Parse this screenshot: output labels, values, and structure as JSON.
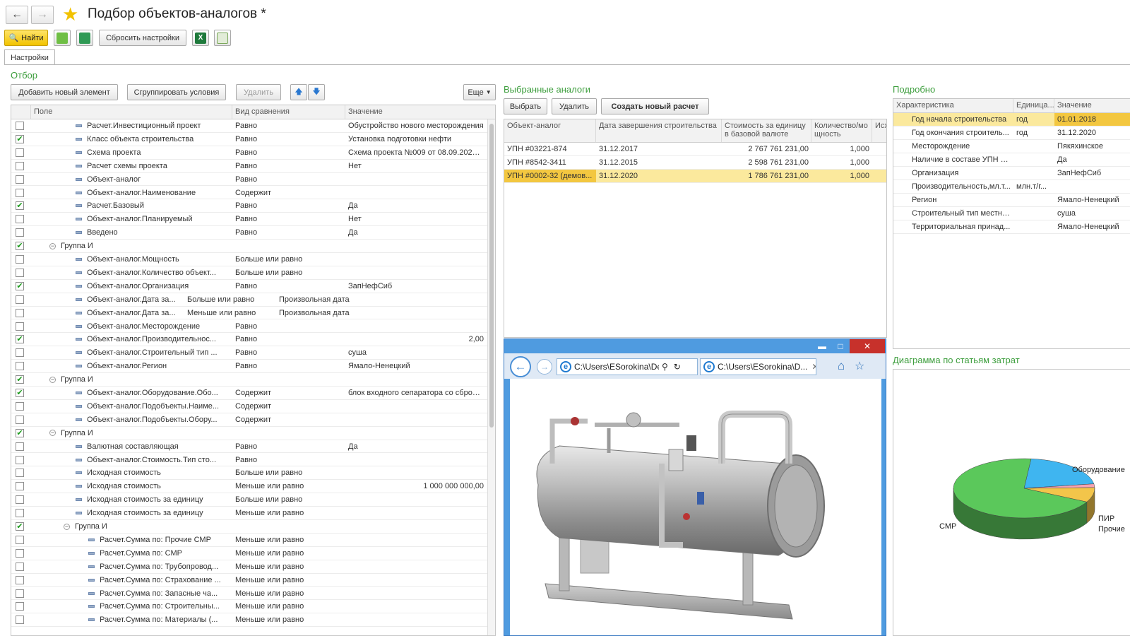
{
  "window": {
    "title": "Подбор объектов-аналогов *"
  },
  "toolbar": {
    "find_label": "Найти",
    "reset_label": "Сбросить настройки"
  },
  "tabs": [
    {
      "label": "Настройки"
    }
  ],
  "filter": {
    "section_title": "Отбор",
    "add_label": "Добавить новый элемент",
    "group_label": "Сгруппировать условия",
    "delete_label": "Удалить",
    "more_label": "Еще",
    "columns": [
      "Поле",
      "Вид сравнения",
      "Значение"
    ],
    "rows": [
      {
        "checked": false,
        "kind": "item",
        "level": 1,
        "field": "Расчет.Инвестиционный проект",
        "cmp": "Равно",
        "value": "Обустройство нового месторождения"
      },
      {
        "checked": true,
        "kind": "item",
        "level": 1,
        "field": "Класс объекта строительства",
        "cmp": "Равно",
        "value": "Установка подготовки нефти"
      },
      {
        "checked": false,
        "kind": "item",
        "level": 1,
        "field": "Схема проекта",
        "cmp": "Равно",
        "value": "Схема проекта №009 от 08.09.2022 14:..."
      },
      {
        "checked": false,
        "kind": "item",
        "level": 1,
        "field": "Расчет схемы проекта",
        "cmp": "Равно",
        "value": "Нет"
      },
      {
        "checked": false,
        "kind": "item",
        "level": 1,
        "field": "Объект-аналог",
        "cmp": "Равно",
        "value": ""
      },
      {
        "checked": false,
        "kind": "item",
        "level": 1,
        "field": "Объект-аналог.Наименование",
        "cmp": "Содержит",
        "value": ""
      },
      {
        "checked": true,
        "kind": "item",
        "level": 1,
        "field": "Расчет.Базовый",
        "cmp": "Равно",
        "value": "Да"
      },
      {
        "checked": false,
        "kind": "item",
        "level": 1,
        "field": "Объект-аналог.Планируемый",
        "cmp": "Равно",
        "value": "Нет"
      },
      {
        "checked": false,
        "kind": "item",
        "level": 1,
        "field": "Введено",
        "cmp": "Равно",
        "value": "Да"
      },
      {
        "checked": true,
        "kind": "group",
        "level": 0,
        "field": "Группа И",
        "cmp": "",
        "value": ""
      },
      {
        "checked": false,
        "kind": "item",
        "level": 1,
        "field": "Объект-аналог.Мощность",
        "cmp": "Больше или равно",
        "value": ""
      },
      {
        "checked": false,
        "kind": "item",
        "level": 1,
        "field": "Объект-аналог.Количество объект...",
        "cmp": "Больше или равно",
        "value": ""
      },
      {
        "checked": true,
        "kind": "item",
        "level": 1,
        "field": "Объект-аналог.Организация",
        "cmp": "Равно",
        "value": "ЗапНефСиб"
      },
      {
        "checked": false,
        "kind": "item",
        "level": 1,
        "field": "Объект-аналог.Дата за...",
        "cmp_inline": "Больше или равно",
        "value_inline": "Произвольная дата",
        "cmp": "",
        "value": ""
      },
      {
        "checked": false,
        "kind": "item",
        "level": 1,
        "field": "Объект-аналог.Дата за...",
        "cmp_inline": "Меньше или равно",
        "value_inline": "Произвольная дата",
        "cmp": "",
        "value": ""
      },
      {
        "checked": false,
        "kind": "item",
        "level": 1,
        "field": "Объект-аналог.Месторождение",
        "cmp": "Равно",
        "value": ""
      },
      {
        "checked": true,
        "kind": "item",
        "level": 1,
        "field": "Объект-аналог.Производительнос...",
        "cmp": "Равно",
        "value": "2,00",
        "num": true
      },
      {
        "checked": false,
        "kind": "item",
        "level": 1,
        "field": "Объект-аналог.Строительный тип ...",
        "cmp": "Равно",
        "value": "суша"
      },
      {
        "checked": false,
        "kind": "item",
        "level": 1,
        "field": "Объект-аналог.Регион",
        "cmp": "Равно",
        "value": "Ямало-Ненецкий"
      },
      {
        "checked": true,
        "kind": "group",
        "level": 0,
        "field": "Группа И",
        "cmp": "",
        "value": ""
      },
      {
        "checked": true,
        "kind": "item",
        "level": 1,
        "field": "Объект-аналог.Оборудование.Обо...",
        "cmp": "Содержит",
        "value": "блок входного сепаратора со сбросом ..."
      },
      {
        "checked": false,
        "kind": "item",
        "level": 1,
        "field": "Объект-аналог.Подобъекты.Наиме...",
        "cmp": "Содержит",
        "value": ""
      },
      {
        "checked": false,
        "kind": "item",
        "level": 1,
        "field": "Объект-аналог.Подобъекты.Обору...",
        "cmp": "Содержит",
        "value": ""
      },
      {
        "checked": true,
        "kind": "group",
        "level": 0,
        "field": "Группа И",
        "cmp": "",
        "value": ""
      },
      {
        "checked": false,
        "kind": "item",
        "level": 1,
        "field": "Валютная составляющая",
        "cmp": "Равно",
        "value": "Да"
      },
      {
        "checked": false,
        "kind": "item",
        "level": 1,
        "field": "Объект-аналог.Стоимость.Тип сто...",
        "cmp": "Равно",
        "value": ""
      },
      {
        "checked": false,
        "kind": "item",
        "level": 1,
        "field": "Исходная стоимость",
        "cmp": "Больше или равно",
        "value": ""
      },
      {
        "checked": false,
        "kind": "item",
        "level": 1,
        "field": "Исходная стоимость",
        "cmp": "Меньше или равно",
        "value": "1 000 000 000,00",
        "num": true
      },
      {
        "checked": false,
        "kind": "item",
        "level": 1,
        "field": "Исходная стоимость за единицу",
        "cmp": "Больше или равно",
        "value": ""
      },
      {
        "checked": false,
        "kind": "item",
        "level": 1,
        "field": "Исходная стоимость за единицу",
        "cmp": "Меньше или равно",
        "value": ""
      },
      {
        "checked": true,
        "kind": "group",
        "level": 1,
        "field": "Группа И",
        "cmp": "",
        "value": ""
      },
      {
        "checked": false,
        "kind": "item",
        "level": 2,
        "field": "Расчет.Сумма по: Прочие СМР",
        "cmp": "Меньше или равно",
        "value": ""
      },
      {
        "checked": false,
        "kind": "item",
        "level": 2,
        "field": "Расчет.Сумма по: СМР",
        "cmp": "Меньше или равно",
        "value": ""
      },
      {
        "checked": false,
        "kind": "item",
        "level": 2,
        "field": "Расчет.Сумма по: Трубопровод...",
        "cmp": "Меньше или равно",
        "value": ""
      },
      {
        "checked": false,
        "kind": "item",
        "level": 2,
        "field": "Расчет.Сумма по: Страхование ...",
        "cmp": "Меньше или равно",
        "value": ""
      },
      {
        "checked": false,
        "kind": "item",
        "level": 2,
        "field": "Расчет.Сумма по: Запасные ча...",
        "cmp": "Меньше или равно",
        "value": ""
      },
      {
        "checked": false,
        "kind": "item",
        "level": 2,
        "field": "Расчет.Сумма по: Строительны...",
        "cmp": "Меньше или равно",
        "value": ""
      },
      {
        "checked": false,
        "kind": "item",
        "level": 2,
        "field": "Расчет.Сумма по: Материалы (...",
        "cmp": "Меньше или равно",
        "value": ""
      }
    ]
  },
  "analogs": {
    "section_title": "Выбранные аналоги",
    "select_label": "Выбрать",
    "delete_label": "Удалить",
    "create_label": "Создать новый расчет",
    "columns": [
      "Объект-аналог",
      "Дата завершения строительства",
      "Стоимость за единицу в базовой валюте",
      "Количество/мощность",
      "Исх"
    ],
    "col_qty_l1": "Количество/мо",
    "col_qty_l2": "щность",
    "col_cost_l1": "Стоимость за единицу",
    "col_cost_l2": "в базовой валюте",
    "rows": [
      {
        "name": "УПН #03221-874",
        "date": "31.12.2017",
        "cost": "2 767 761 231,00",
        "qty": "1,000",
        "selected": false
      },
      {
        "name": "УПН #8542-3411",
        "date": "31.12.2015",
        "cost": "2 598 761 231,00",
        "qty": "1,000",
        "selected": false
      },
      {
        "name": "УПН #0002-32  (демов...",
        "date": "31.12.2020",
        "cost": "1 786 761 231,00",
        "qty": "1,000",
        "selected": true
      }
    ]
  },
  "browser": {
    "tab1": "C:\\Users\\ESorokina\\De",
    "tab2": "C:\\Users\\ESorokina\\D..."
  },
  "details": {
    "section_title": "Подробно",
    "columns": [
      "Характеристика",
      "Единица...",
      "Значение"
    ],
    "rows": [
      {
        "name": "Год начала строительства",
        "unit": "год",
        "value": "01.01.2018",
        "selected": true
      },
      {
        "name": "Год окончания строитель...",
        "unit": "год",
        "value": "31.12.2020",
        "selected": false
      },
      {
        "name": "Месторождение",
        "unit": "",
        "value": "Пякяхинское",
        "selected": false
      },
      {
        "name": "Наличие в составе УПН б...",
        "unit": "",
        "value": "Да",
        "selected": false
      },
      {
        "name": "Организация",
        "unit": "",
        "value": "ЗапНефСиб",
        "selected": false
      },
      {
        "name": "Производительность,мл.т...",
        "unit": "млн.т/г...",
        "value": "",
        "selected": false
      },
      {
        "name": "Регион",
        "unit": "",
        "value": "Ямало-Ненецкий",
        "selected": false
      },
      {
        "name": "Строительный тип местно...",
        "unit": "",
        "value": "суша",
        "selected": false
      },
      {
        "name": "Территориальная принад...",
        "unit": "",
        "value": "Ямало-Ненецкий",
        "selected": false
      }
    ]
  },
  "chart_data": {
    "type": "pie",
    "title": "Диаграмма по статьям затрат",
    "categories": [
      "Оборудование",
      "ПИР",
      "Прочие",
      "СМР"
    ],
    "values": [
      21,
      2,
      8,
      69
    ],
    "colors": [
      "#3fb5f0",
      "#f4a3b4",
      "#f3c54a",
      "#5bc85b"
    ],
    "legend": "none"
  }
}
